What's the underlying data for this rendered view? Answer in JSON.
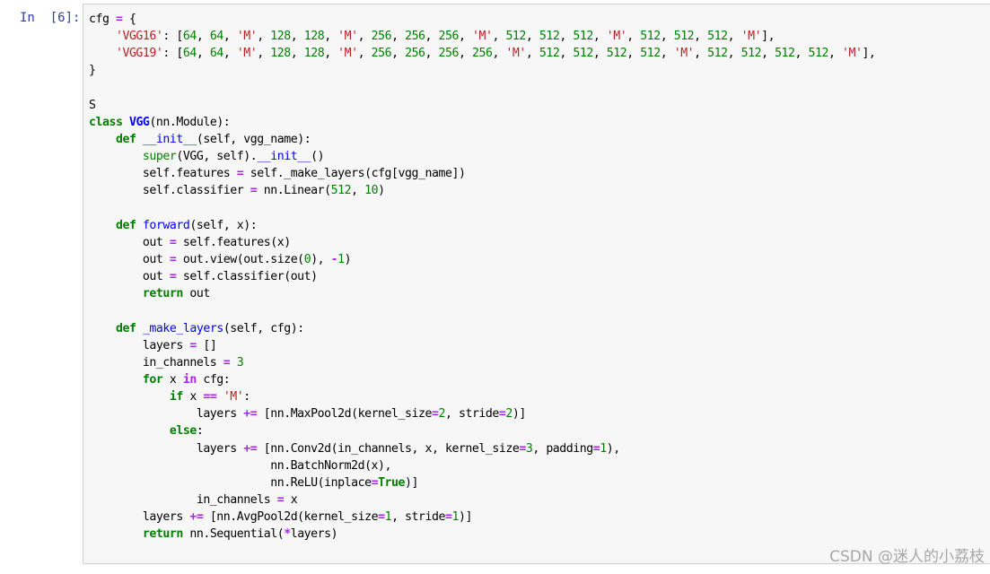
{
  "cell": {
    "prompt": "In  [6]:",
    "lines": [
      [
        {
          "t": "cfg "
        },
        {
          "t": "=",
          "c": "op"
        },
        {
          "t": " {"
        }
      ],
      [
        {
          "t": "    "
        },
        {
          "t": "'VGG16'",
          "c": "str"
        },
        {
          "t": ": ["
        },
        {
          "t": "64",
          "c": "num"
        },
        {
          "t": ", "
        },
        {
          "t": "64",
          "c": "num"
        },
        {
          "t": ", "
        },
        {
          "t": "'M'",
          "c": "str"
        },
        {
          "t": ", "
        },
        {
          "t": "128",
          "c": "num"
        },
        {
          "t": ", "
        },
        {
          "t": "128",
          "c": "num"
        },
        {
          "t": ", "
        },
        {
          "t": "'M'",
          "c": "str"
        },
        {
          "t": ", "
        },
        {
          "t": "256",
          "c": "num"
        },
        {
          "t": ", "
        },
        {
          "t": "256",
          "c": "num"
        },
        {
          "t": ", "
        },
        {
          "t": "256",
          "c": "num"
        },
        {
          "t": ", "
        },
        {
          "t": "'M'",
          "c": "str"
        },
        {
          "t": ", "
        },
        {
          "t": "512",
          "c": "num"
        },
        {
          "t": ", "
        },
        {
          "t": "512",
          "c": "num"
        },
        {
          "t": ", "
        },
        {
          "t": "512",
          "c": "num"
        },
        {
          "t": ", "
        },
        {
          "t": "'M'",
          "c": "str"
        },
        {
          "t": ", "
        },
        {
          "t": "512",
          "c": "num"
        },
        {
          "t": ", "
        },
        {
          "t": "512",
          "c": "num"
        },
        {
          "t": ", "
        },
        {
          "t": "512",
          "c": "num"
        },
        {
          "t": ", "
        },
        {
          "t": "'M'",
          "c": "str"
        },
        {
          "t": "],"
        }
      ],
      [
        {
          "t": "    "
        },
        {
          "t": "'VGG19'",
          "c": "str"
        },
        {
          "t": ": ["
        },
        {
          "t": "64",
          "c": "num"
        },
        {
          "t": ", "
        },
        {
          "t": "64",
          "c": "num"
        },
        {
          "t": ", "
        },
        {
          "t": "'M'",
          "c": "str"
        },
        {
          "t": ", "
        },
        {
          "t": "128",
          "c": "num"
        },
        {
          "t": ", "
        },
        {
          "t": "128",
          "c": "num"
        },
        {
          "t": ", "
        },
        {
          "t": "'M'",
          "c": "str"
        },
        {
          "t": ", "
        },
        {
          "t": "256",
          "c": "num"
        },
        {
          "t": ", "
        },
        {
          "t": "256",
          "c": "num"
        },
        {
          "t": ", "
        },
        {
          "t": "256",
          "c": "num"
        },
        {
          "t": ", "
        },
        {
          "t": "256",
          "c": "num"
        },
        {
          "t": ", "
        },
        {
          "t": "'M'",
          "c": "str"
        },
        {
          "t": ", "
        },
        {
          "t": "512",
          "c": "num"
        },
        {
          "t": ", "
        },
        {
          "t": "512",
          "c": "num"
        },
        {
          "t": ", "
        },
        {
          "t": "512",
          "c": "num"
        },
        {
          "t": ", "
        },
        {
          "t": "512",
          "c": "num"
        },
        {
          "t": ", "
        },
        {
          "t": "'M'",
          "c": "str"
        },
        {
          "t": ", "
        },
        {
          "t": "512",
          "c": "num"
        },
        {
          "t": ", "
        },
        {
          "t": "512",
          "c": "num"
        },
        {
          "t": ", "
        },
        {
          "t": "512",
          "c": "num"
        },
        {
          "t": ", "
        },
        {
          "t": "512",
          "c": "num"
        },
        {
          "t": ", "
        },
        {
          "t": "'M'",
          "c": "str"
        },
        {
          "t": "],"
        }
      ],
      [
        {
          "t": "}"
        }
      ],
      [],
      [
        {
          "t": "S"
        }
      ],
      [
        {
          "t": "class",
          "c": "kw"
        },
        {
          "t": " "
        },
        {
          "t": "VGG",
          "c": "cls"
        },
        {
          "t": "(nn.Module):"
        }
      ],
      [
        {
          "t": "    "
        },
        {
          "t": "def",
          "c": "kw"
        },
        {
          "t": " "
        },
        {
          "t": "__init__",
          "c": "fn"
        },
        {
          "t": "(self, vgg_name):"
        }
      ],
      [
        {
          "t": "        "
        },
        {
          "t": "super",
          "c": "bi"
        },
        {
          "t": "(VGG, self)."
        },
        {
          "t": "__init__",
          "c": "fn"
        },
        {
          "t": "()"
        }
      ],
      [
        {
          "t": "        self.features "
        },
        {
          "t": "=",
          "c": "op"
        },
        {
          "t": " self._make_layers(cfg[vgg_name])"
        }
      ],
      [
        {
          "t": "        self.classifier "
        },
        {
          "t": "=",
          "c": "op"
        },
        {
          "t": " nn.Linear("
        },
        {
          "t": "512",
          "c": "num"
        },
        {
          "t": ", "
        },
        {
          "t": "10",
          "c": "num"
        },
        {
          "t": ")"
        }
      ],
      [],
      [
        {
          "t": "    "
        },
        {
          "t": "def",
          "c": "kw"
        },
        {
          "t": " "
        },
        {
          "t": "forward",
          "c": "fn"
        },
        {
          "t": "(self, x):"
        }
      ],
      [
        {
          "t": "        out "
        },
        {
          "t": "=",
          "c": "op"
        },
        {
          "t": " self.features(x)"
        }
      ],
      [
        {
          "t": "        out "
        },
        {
          "t": "=",
          "c": "op"
        },
        {
          "t": " out.view(out.size("
        },
        {
          "t": "0",
          "c": "num"
        },
        {
          "t": "), "
        },
        {
          "t": "-",
          "c": "op"
        },
        {
          "t": "1",
          "c": "num"
        },
        {
          "t": ")"
        }
      ],
      [
        {
          "t": "        out "
        },
        {
          "t": "=",
          "c": "op"
        },
        {
          "t": " self.classifier(out)"
        }
      ],
      [
        {
          "t": "        "
        },
        {
          "t": "return",
          "c": "kw"
        },
        {
          "t": " out"
        }
      ],
      [],
      [
        {
          "t": "    "
        },
        {
          "t": "def",
          "c": "kw"
        },
        {
          "t": " "
        },
        {
          "t": "_make_layers",
          "c": "fn"
        },
        {
          "t": "(self, cfg):"
        }
      ],
      [
        {
          "t": "        layers "
        },
        {
          "t": "=",
          "c": "op"
        },
        {
          "t": " []"
        }
      ],
      [
        {
          "t": "        in_channels "
        },
        {
          "t": "=",
          "c": "op"
        },
        {
          "t": " "
        },
        {
          "t": "3",
          "c": "num"
        }
      ],
      [
        {
          "t": "        "
        },
        {
          "t": "for",
          "c": "kw"
        },
        {
          "t": " x "
        },
        {
          "t": "in",
          "c": "op"
        },
        {
          "t": " cfg:"
        }
      ],
      [
        {
          "t": "            "
        },
        {
          "t": "if",
          "c": "kw"
        },
        {
          "t": " x "
        },
        {
          "t": "==",
          "c": "op"
        },
        {
          "t": " "
        },
        {
          "t": "'M'",
          "c": "str"
        },
        {
          "t": ":"
        }
      ],
      [
        {
          "t": "                layers "
        },
        {
          "t": "+=",
          "c": "op"
        },
        {
          "t": " [nn.MaxPool2d(kernel_size"
        },
        {
          "t": "=",
          "c": "op"
        },
        {
          "t": "2",
          "c": "num"
        },
        {
          "t": ", stride"
        },
        {
          "t": "=",
          "c": "op"
        },
        {
          "t": "2",
          "c": "num"
        },
        {
          "t": ")]"
        }
      ],
      [
        {
          "t": "            "
        },
        {
          "t": "else",
          "c": "kw"
        },
        {
          "t": ":"
        }
      ],
      [
        {
          "t": "                layers "
        },
        {
          "t": "+=",
          "c": "op"
        },
        {
          "t": " [nn.Conv2d(in_channels, x, kernel_size"
        },
        {
          "t": "=",
          "c": "op"
        },
        {
          "t": "3",
          "c": "num"
        },
        {
          "t": ", padding"
        },
        {
          "t": "=",
          "c": "op"
        },
        {
          "t": "1",
          "c": "num"
        },
        {
          "t": "),"
        }
      ],
      [
        {
          "t": "                           nn.BatchNorm2d(x),"
        }
      ],
      [
        {
          "t": "                           nn.ReLU(inplace"
        },
        {
          "t": "=",
          "c": "op"
        },
        {
          "t": "True",
          "c": "kw"
        },
        {
          "t": ")]"
        }
      ],
      [
        {
          "t": "                in_channels "
        },
        {
          "t": "=",
          "c": "op"
        },
        {
          "t": " x"
        }
      ],
      [
        {
          "t": "        layers "
        },
        {
          "t": "+=",
          "c": "op"
        },
        {
          "t": " [nn.AvgPool2d(kernel_size"
        },
        {
          "t": "=",
          "c": "op"
        },
        {
          "t": "1",
          "c": "num"
        },
        {
          "t": ", stride"
        },
        {
          "t": "=",
          "c": "op"
        },
        {
          "t": "1",
          "c": "num"
        },
        {
          "t": ")]"
        }
      ],
      [
        {
          "t": "        "
        },
        {
          "t": "return",
          "c": "kw"
        },
        {
          "t": " nn.Sequential("
        },
        {
          "t": "*",
          "c": "op"
        },
        {
          "t": "layers)"
        }
      ]
    ]
  },
  "watermark": "CSDN @迷人的小荔枝",
  "colors": {
    "prompt": "#303f9f",
    "keyword": "#008000",
    "operator": "#aa22ff",
    "string": "#ba2121",
    "number": "#008000",
    "function_name": "#0000ff",
    "cell_background": "#f7f7f7",
    "cell_border": "#cfcfcf"
  }
}
